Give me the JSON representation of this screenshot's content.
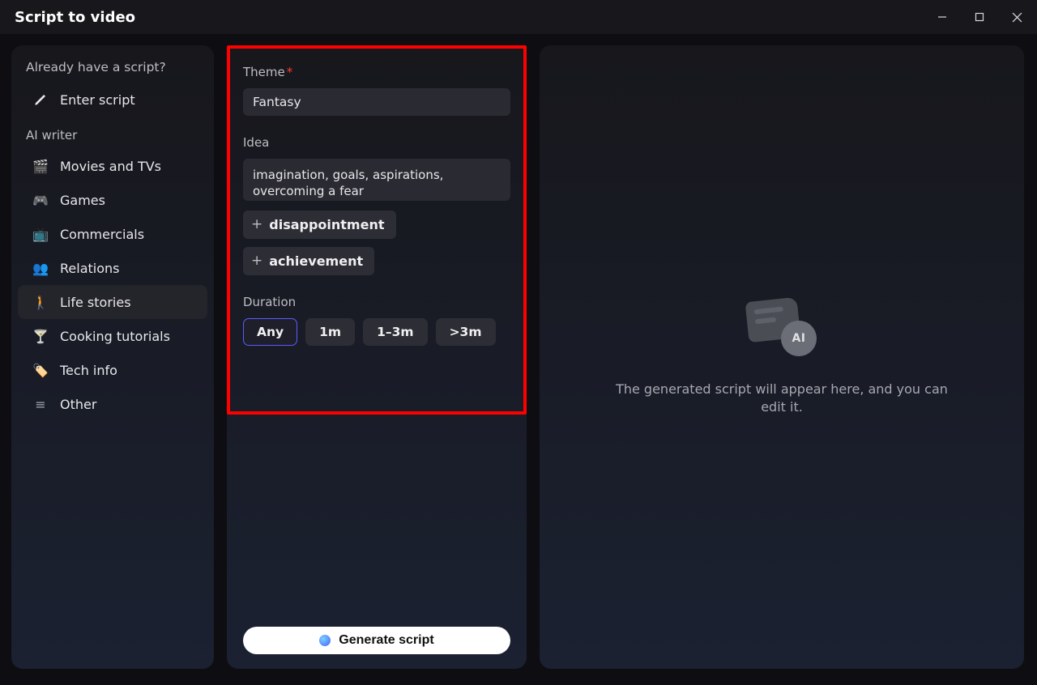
{
  "window": {
    "title": "Script to video"
  },
  "sidebar": {
    "prompt": "Already have a script?",
    "enter_script": "Enter script",
    "section": "AI writer",
    "items": [
      {
        "icon": "🎬",
        "label": "Movies and TVs",
        "color": "#6a7cff"
      },
      {
        "icon": "🎮",
        "label": "Games",
        "color": "#b565ff"
      },
      {
        "icon": "📺",
        "label": "Commercials",
        "color": "#3ea0ff"
      },
      {
        "icon": "👥",
        "label": "Relations",
        "color": "#7a4bff"
      },
      {
        "icon": "🚶",
        "label": "Life stories",
        "color": "#38cfc4",
        "active": true
      },
      {
        "icon": "🍸",
        "label": "Cooking tutorials",
        "color": "#914bff"
      },
      {
        "icon": "🏷️",
        "label": "Tech info",
        "color": "#2ea6ff"
      },
      {
        "icon": "≡",
        "label": "Other",
        "color": "#a3a6b2"
      }
    ]
  },
  "form": {
    "theme_label": "Theme",
    "theme_value": "Fantasy",
    "idea_label": "Idea",
    "idea_value": "imagination, goals, aspirations, overcoming a fear",
    "chips": [
      "disappointment",
      "achievement"
    ],
    "duration_label": "Duration",
    "duration_options": [
      "Any",
      "1m",
      "1–3m",
      ">3m"
    ],
    "duration_selected": "Any",
    "generate_label": "Generate script"
  },
  "preview": {
    "badge": "AI",
    "message": "The generated script will appear here, and you can edit it."
  }
}
